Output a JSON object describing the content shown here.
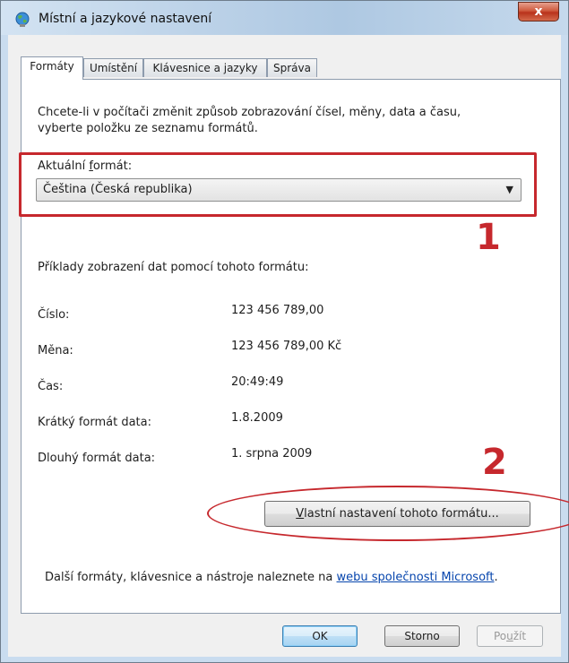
{
  "window": {
    "title": "Místní a jazykové nastavení",
    "close_glyph": "x",
    "app_icon": "globe-icon"
  },
  "tabs": [
    {
      "label": "Formáty",
      "active": true
    },
    {
      "label": "Umístění",
      "active": false
    },
    {
      "label": "Klávesnice a jazyky",
      "active": false
    },
    {
      "label": "Správa",
      "active": false
    }
  ],
  "formats": {
    "intro_line1": "Chcete-li v počítači změnit způsob zobrazování čísel, měny, data a času,",
    "intro_line2": "vyberte položku ze seznamu formátů.",
    "current_label_pre": "Aktuální ",
    "current_label_key": "f",
    "current_label_post": "ormát:",
    "current_value": "Čeština (Česká republika)",
    "examples_title": "Příklady zobrazení dat pomocí tohoto formátu:",
    "examples": [
      {
        "label": "Číslo:",
        "value": "123 456 789,00"
      },
      {
        "label": "Měna:",
        "value": "123 456 789,00 Kč"
      },
      {
        "label": "Čas:",
        "value": "20:49:49"
      },
      {
        "label": "Krátký formát data:",
        "value": "1.8.2009"
      },
      {
        "label": "Dlouhý formát data:",
        "value": "1. srpna 2009"
      }
    ],
    "custom_button_key": "V",
    "custom_button_rest": "lastní nastavení tohoto formátu...",
    "footer_text": "Další formáty, klávesnice a nástroje naleznete na ",
    "footer_link": "webu společnosti Microsoft",
    "footer_end": "."
  },
  "annotations": {
    "marker1": "1",
    "marker2": "2",
    "color": "#c6282d"
  },
  "buttons": {
    "ok": "OK",
    "cancel": "Storno",
    "apply_pre": "Po",
    "apply_key": "u",
    "apply_post": "žít"
  }
}
